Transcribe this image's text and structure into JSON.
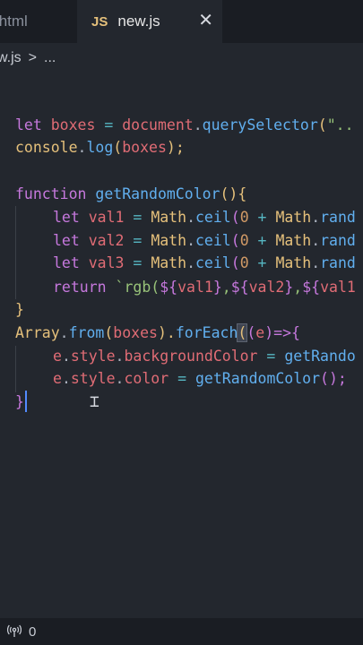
{
  "tabs": {
    "inactive_label": ".html",
    "active_icon": "JS",
    "active_label": "new.js",
    "close_glyph": "✕"
  },
  "breadcrumb": {
    "file": "w.js",
    "separator": ">",
    "more": "..."
  },
  "code": {
    "l1": {
      "a": "let",
      "b": "boxes",
      "c": " = ",
      "d": "document",
      ".": ".",
      "e": "querySelector",
      "f": "(",
      "g": "\".."
    },
    "l2": {
      "a": "console",
      "b": ".",
      "c": "log",
      "d": "(",
      "e": "boxes",
      "f": ");"
    },
    "l3": {
      "a": "function",
      "b": "getRandomColor",
      "c": "(){"
    },
    "l4": {
      "a": "let",
      "b": "val1",
      "c": " = ",
      "d": "Math",
      "e": ".",
      "f": "ceil",
      "g": "(",
      "h": "0",
      "i": " + ",
      "j": "Math",
      "k": ".",
      "l": "rand"
    },
    "l5": {
      "a": "let",
      "b": "val2",
      "c": " = ",
      "d": "Math",
      "e": ".",
      "f": "ceil",
      "g": "(",
      "h": "0",
      "i": " + ",
      "j": "Math",
      "k": ".",
      "l": "rand"
    },
    "l6": {
      "a": "let",
      "b": "val3",
      "c": " = ",
      "d": "Math",
      "e": ".",
      "f": "ceil",
      "g": "(",
      "h": "0",
      "i": " + ",
      "j": "Math",
      "k": ".",
      "l": "rand"
    },
    "l7": {
      "a": "return",
      "b": " `rgb(",
      "c": "${",
      "d": "val1",
      "e": "}",
      ",": ",",
      "f": "${",
      "g": "val2",
      "h": "}",
      "i": ",",
      "j": "${",
      "k": "val1"
    },
    "l8": {
      "a": "}"
    },
    "l9": {
      "a": "Array",
      "b": ".",
      "c": "from",
      "d": "(",
      "e": "boxes",
      "f": ").",
      "g": "forEach",
      "h": "(",
      "i": "(",
      "j": "e",
      "k": ")",
      "l": "=>",
      "m": "{"
    },
    "l10": {
      "a": "e",
      "b": ".",
      "c": "style",
      "d": ".",
      "e": "backgroundColor",
      "f": " = ",
      "g": "getRando"
    },
    "l11": {
      "a": "e",
      "b": ".",
      "c": "style",
      "d": ".",
      "e": "color",
      "f": " = ",
      "g": "getRandomColor",
      "h": "();"
    },
    "l12": {
      "a": "}"
    }
  },
  "status": {
    "broadcast_icon": "broadcast-icon",
    "count": "0"
  },
  "colors": {
    "keyword": "#c678dd",
    "variable": "#e06c75",
    "function": "#61afef",
    "class": "#e5c07b",
    "string": "#98c379",
    "operator": "#56b6c2",
    "number": "#d19a66"
  }
}
